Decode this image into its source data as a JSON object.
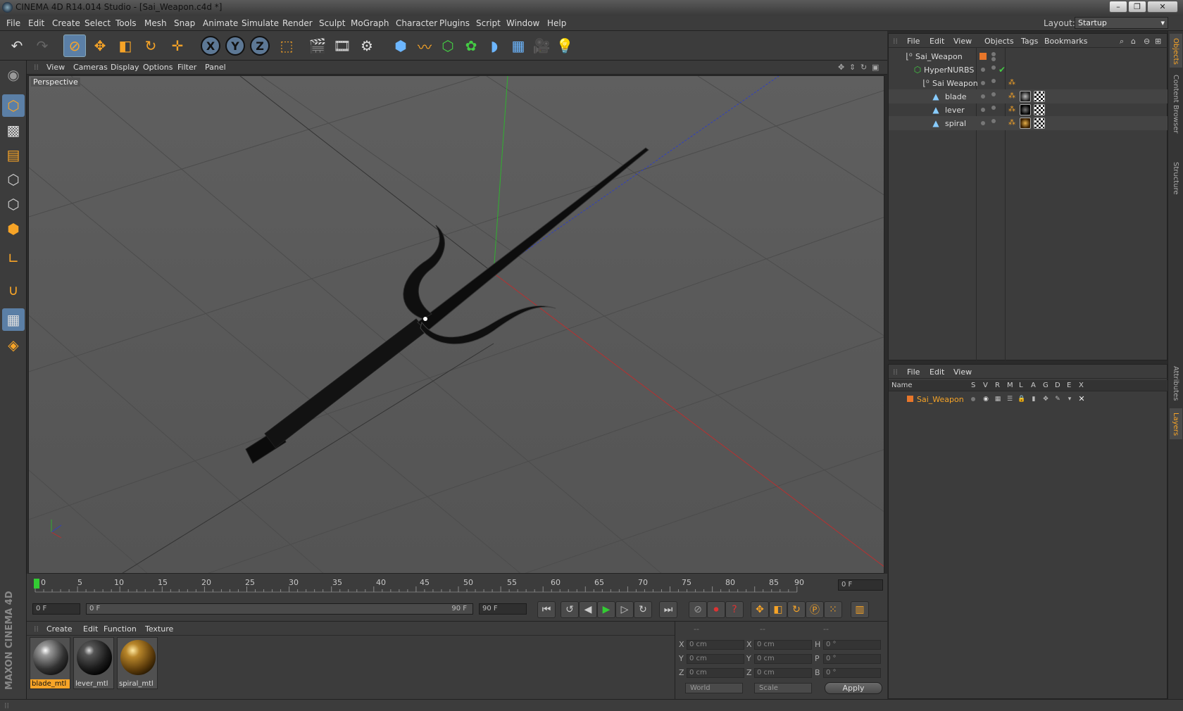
{
  "window": {
    "title": "CINEMA 4D R14.014 Studio - [Sai_Weapon.c4d *]",
    "minimize": "–",
    "restore": "❐",
    "close": "✕"
  },
  "menu": [
    "File",
    "Edit",
    "Create",
    "Select",
    "Tools",
    "Mesh",
    "Snap",
    "Animate",
    "Simulate",
    "Render",
    "Sculpt",
    "MoGraph",
    "Character",
    "Plugins",
    "Script",
    "Window",
    "Help"
  ],
  "layout": {
    "label": "Layout:",
    "value": "Startup"
  },
  "toolbar": {
    "x": "X",
    "y": "Y",
    "z": "Z"
  },
  "viewport": {
    "menu": [
      "View",
      "Cameras",
      "Display",
      "Options",
      "Filter",
      "Panel"
    ],
    "label": "Perspective"
  },
  "timeline": {
    "ticks": [
      "0",
      "5",
      "10",
      "15",
      "20",
      "25",
      "30",
      "35",
      "40",
      "45",
      "50",
      "55",
      "60",
      "65",
      "70",
      "75",
      "80",
      "85",
      "90"
    ],
    "current": "0 F"
  },
  "playbar": {
    "start": "0 F",
    "range_start": "0 F",
    "range_end": "90 F",
    "end": "90 F"
  },
  "materials": {
    "menu": [
      "Create",
      "Edit",
      "Function",
      "Texture"
    ],
    "items": [
      {
        "name": "blade_mtl",
        "selected": true
      },
      {
        "name": "lever_mtl",
        "selected": false
      },
      {
        "name": "spiral_mtl",
        "selected": false
      }
    ]
  },
  "coords": {
    "headers": [
      "--",
      "--",
      "--"
    ],
    "rows": [
      {
        "l1": "X",
        "v1": "0 cm",
        "l2": "X",
        "v2": "0 cm",
        "l3": "H",
        "v3": "0 °"
      },
      {
        "l1": "Y",
        "v1": "0 cm",
        "l2": "Y",
        "v2": "0 cm",
        "l3": "P",
        "v3": "0 °"
      },
      {
        "l1": "Z",
        "v1": "0 cm",
        "l2": "Z",
        "v2": "0 cm",
        "l3": "B",
        "v3": "0 °"
      }
    ],
    "mode": "World",
    "type": "Scale",
    "apply": "Apply"
  },
  "objects": {
    "menu": [
      "File",
      "Edit",
      "View",
      "Objects",
      "Tags",
      "Bookmarks"
    ],
    "items": [
      {
        "name": "Sai_Weapon"
      },
      {
        "name": "HyperNURBS"
      },
      {
        "name": "Sai Weapon"
      },
      {
        "name": "blade"
      },
      {
        "name": "lever"
      },
      {
        "name": "spiral"
      }
    ]
  },
  "layers": {
    "menu": [
      "File",
      "Edit",
      "View"
    ],
    "columns": [
      "Name",
      "S",
      "V",
      "R",
      "M",
      "L",
      "A",
      "G",
      "D",
      "E",
      "X"
    ],
    "items": [
      {
        "name": "Sai_Weapon",
        "color": "#e8762a"
      }
    ]
  },
  "sidetabs": [
    "Objects",
    "Content Browser",
    "Structure",
    "Attributes",
    "Layers"
  ],
  "brand": "MAXON CINEMA 4D",
  "colors": {
    "accent": "#f7a427",
    "selection": "#5b7fa6",
    "axis_x": "#c03030",
    "axis_y": "#30b030",
    "axis_z": "#3040c0"
  }
}
